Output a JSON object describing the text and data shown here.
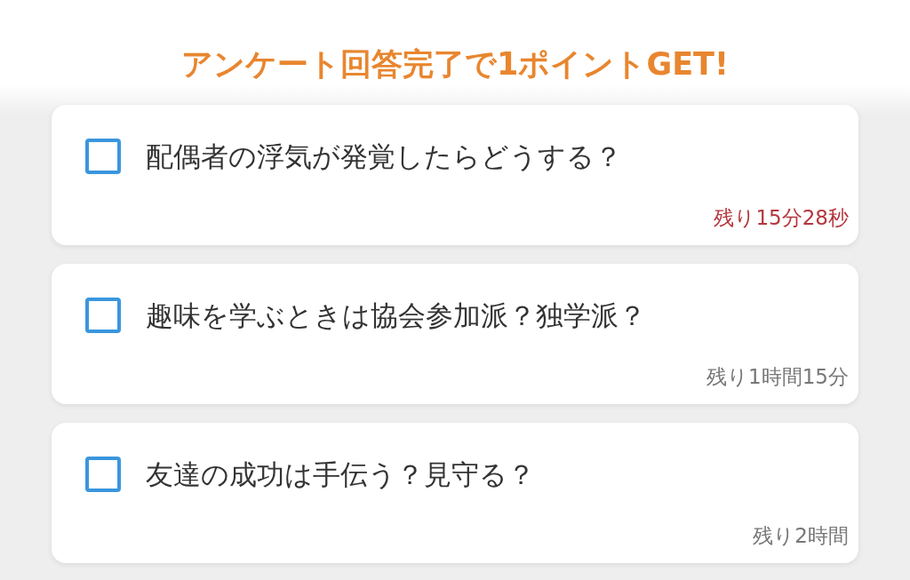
{
  "header": {
    "title": "アンケート回答完了で1ポイントGET!"
  },
  "surveys": [
    {
      "question": "配偶者の浮気が発覚したらどうする？",
      "checked": false,
      "remaining": "残り15分28秒",
      "urgent": true
    },
    {
      "question": "趣味を学ぶときは協会参加派？独学派？",
      "checked": false,
      "remaining": "残り1時間15分",
      "urgent": false
    },
    {
      "question": "友達の成功は手伝う？見守る？",
      "checked": false,
      "remaining": "残り2時間",
      "urgent": false
    }
  ]
}
